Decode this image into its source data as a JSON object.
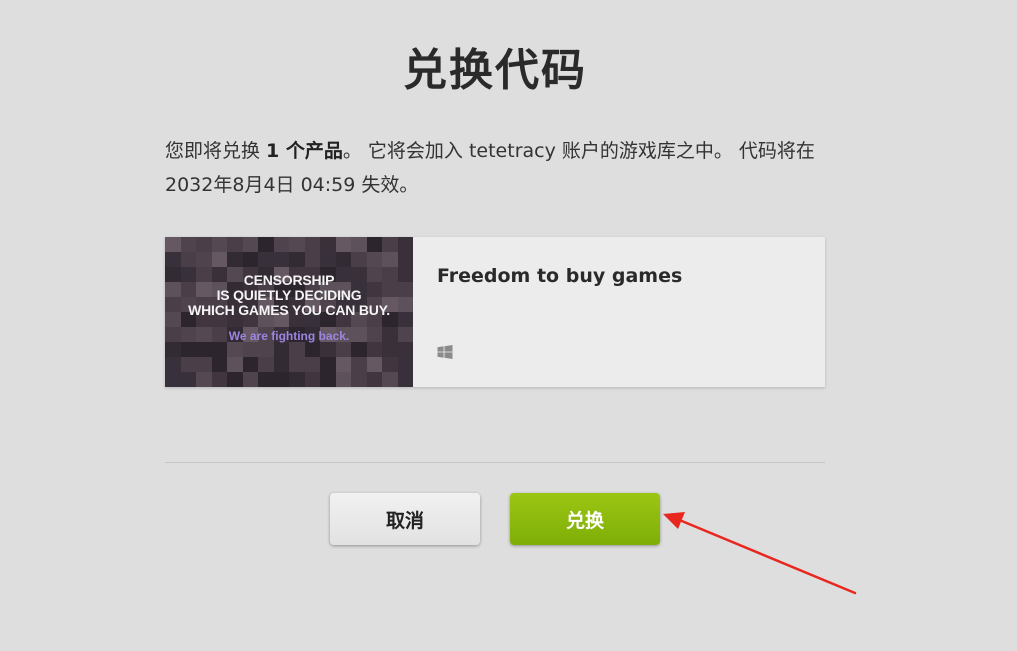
{
  "page": {
    "title": "兑换代码"
  },
  "description": {
    "part1": "您即将兑换 ",
    "count_text": "1 个产品",
    "part2": "。 它将会加入 tetetracy 账户的游戏库之中。 代码将在 2032年8月4日 04:59 失效。"
  },
  "product": {
    "title": "Freedom to buy games",
    "image_headline_1": "CENSORSHIP",
    "image_headline_2": "IS QUIETLY DECIDING",
    "image_headline_3": "WHICH GAMES YOU CAN BUY.",
    "image_subline": "We are fighting back.",
    "platform_icon": "windows-icon"
  },
  "actions": {
    "cancel_label": "取消",
    "redeem_label": "兑换"
  },
  "colors": {
    "background": "#dedede",
    "redeem_button": "#8bbb0c",
    "cancel_button": "#e8e8e8",
    "annotation_arrow": "#e8281e",
    "image_subline": "#9b86e0"
  }
}
